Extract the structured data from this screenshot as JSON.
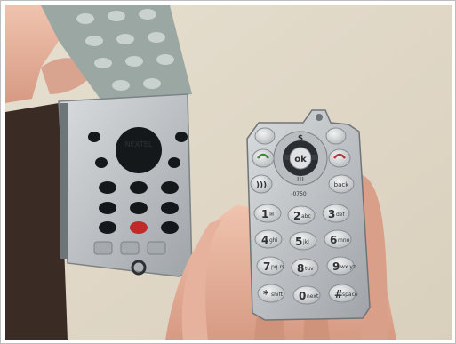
{
  "photo": {
    "subject": "",
    "colors": {
      "wall": "#e9e2d3",
      "skin": "#e8b8a4",
      "keypad_silver": "#bfc2c4",
      "key_body": "#dfe1e2",
      "board_silver": "#c9cdd0",
      "board_holes": "#14171a",
      "dark_bg": "#3a2c24"
    }
  },
  "keypad": {
    "model_text": "-0750",
    "nav_center": "ok",
    "nav_top": "$",
    "nav_bottom": "!!!",
    "keys": [
      {
        "main": "1",
        "sub": "✉"
      },
      {
        "main": "2",
        "sub": "abc"
      },
      {
        "main": "3",
        "sub": "def"
      },
      {
        "main": "4",
        "sub": "ghi"
      },
      {
        "main": "5",
        "sub": "jkl"
      },
      {
        "main": "6",
        "sub": "mno"
      },
      {
        "main": "7",
        "sub": "pq rs"
      },
      {
        "main": "8",
        "sub": "tuv"
      },
      {
        "main": "9",
        "sub": "wx yz"
      },
      {
        "main": "*",
        "sub": "shift"
      },
      {
        "main": "0",
        "sub": "next"
      },
      {
        "main": "#",
        "sub": "space"
      }
    ],
    "back_label": "back"
  },
  "board": {
    "brand_text": "NEXTEL"
  }
}
